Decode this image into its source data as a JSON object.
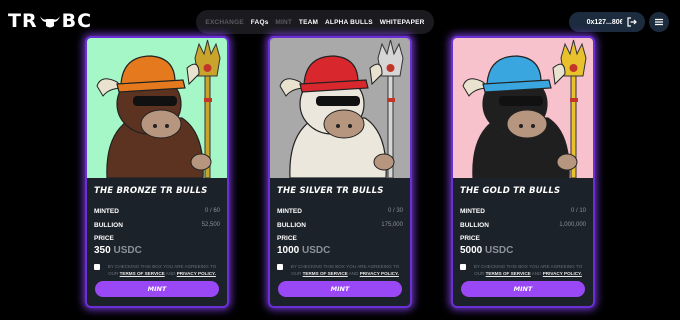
{
  "header": {
    "logo_left": "TR",
    "logo_right": "BC",
    "nav": [
      {
        "label": "EXCHANGE",
        "dim": true
      },
      {
        "label": "FAQs",
        "dim": false
      },
      {
        "label": "MINT",
        "dim": true
      },
      {
        "label": "TEAM",
        "dim": false
      },
      {
        "label": "ALPHA BULLS",
        "dim": false
      },
      {
        "label": "WHITEPAPER",
        "dim": false
      }
    ],
    "wallet": "0x127...8069",
    "icons": [
      "logout-icon",
      "menu-icon"
    ]
  },
  "cards": [
    {
      "title": "THE BRONZE TR BULLS",
      "minted_label": "MINTED",
      "minted_value": "0 / 60",
      "bullion_label": "BULLION",
      "bullion_value": "52,500",
      "price_label": "PRICE",
      "price_value": "350",
      "currency": "USDC",
      "terms_prefix": "BY CHECKING THIS BOX YOU ARE AGREEING TO OUR",
      "terms_link": "TERMS OF SERVICE",
      "terms_and": "AND",
      "privacy_link": "PRIVACY POLICY.",
      "mint_label": "MINT",
      "bg": "#a6f7c8",
      "hat": "#e47a1d",
      "fur": "#5b3320",
      "scepter": "#c9a42c"
    },
    {
      "title": "THE SILVER TR BULLS",
      "minted_label": "MINTED",
      "minted_value": "0 / 30",
      "bullion_label": "BULLION",
      "bullion_value": "175,000",
      "price_label": "PRICE",
      "price_value": "1000",
      "currency": "USDC",
      "terms_prefix": "BY CHECKING THIS BOX YOU ARE AGREEING TO OUR",
      "terms_link": "TERMS OF SERVICE",
      "terms_and": "AND",
      "privacy_link": "PRIVACY POLICY.",
      "mint_label": "MINT",
      "bg": "#a9a9a9",
      "hat": "#d8272d",
      "fur": "#ece7dc",
      "scepter": "#d6d6d6"
    },
    {
      "title": "THE GOLD TR BULLS",
      "minted_label": "MINTED",
      "minted_value": "0 / 10",
      "bullion_label": "BULLION",
      "bullion_value": "1,000,000",
      "price_label": "PRICE",
      "price_value": "5000",
      "currency": "USDC",
      "terms_prefix": "BY CHECKING THIS BOX YOU ARE AGREEING TO OUR",
      "terms_link": "TERMS OF SERVICE",
      "terms_and": "AND",
      "privacy_link": "PRIVACY POLICY.",
      "mint_label": "MINT",
      "bg": "#f8c2cd",
      "hat": "#3aa6e0",
      "fur": "#1f1f1f",
      "scepter": "#e7c22c"
    }
  ]
}
